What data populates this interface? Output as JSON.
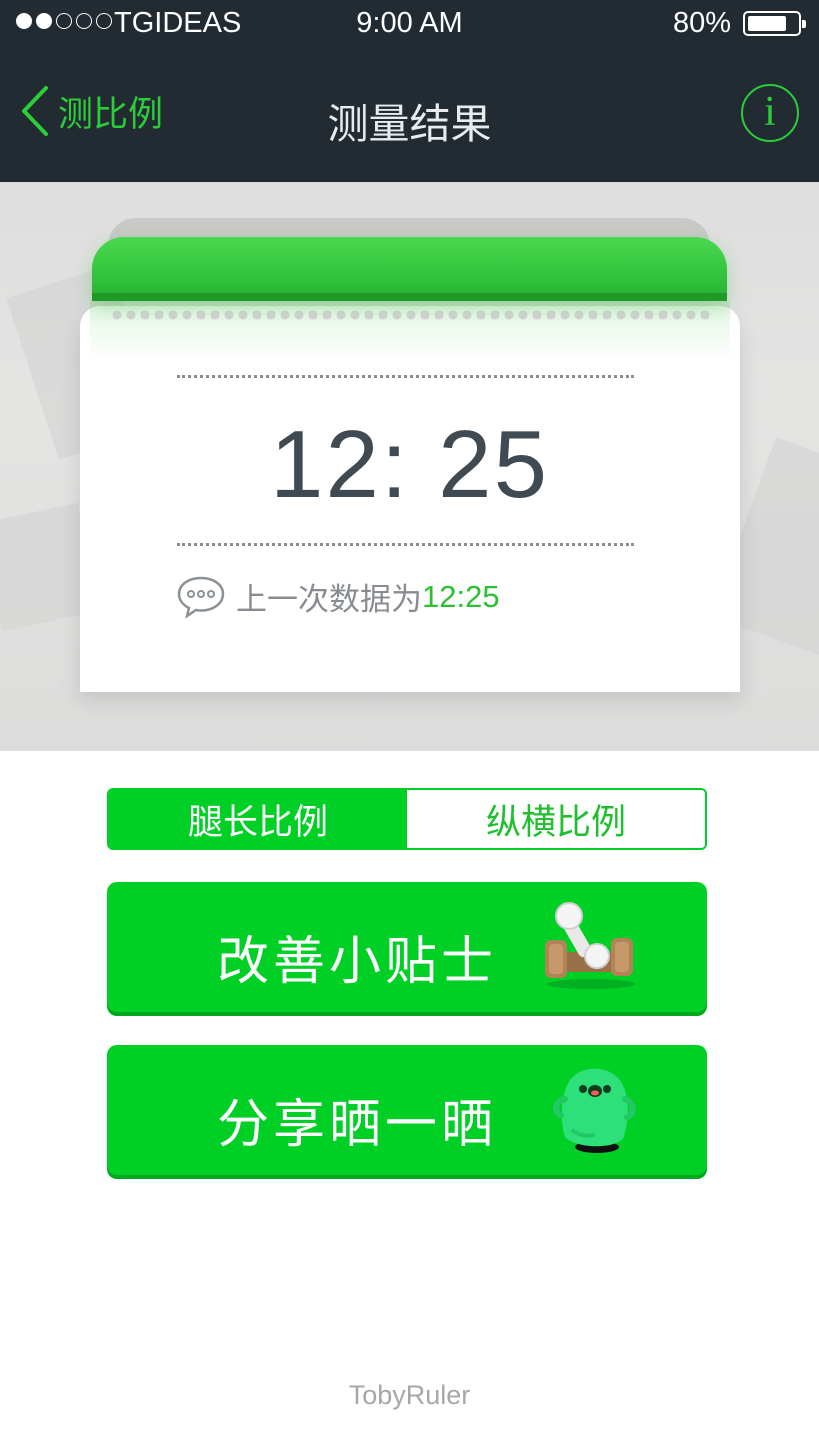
{
  "status_bar": {
    "carrier": "TGIDEAS",
    "time": "9:00 AM",
    "battery_text": "80%",
    "battery_level": 0.8,
    "signal_filled": 2,
    "signal_total": 5
  },
  "nav": {
    "back_label": "测比例",
    "title": "测量结果",
    "info_glyph": "i"
  },
  "result": {
    "value": "12: 25",
    "previous_label": "上一次数据为",
    "previous_value": "12:25"
  },
  "segments": [
    {
      "label": "腿长比例",
      "selected": true
    },
    {
      "label": "纵横比例",
      "selected": false
    }
  ],
  "buttons": {
    "tips_label": "改善小贴士",
    "tips_icon": "dumbbell-icon",
    "share_label": "分享晒一晒",
    "share_icon": "mascot-icon"
  },
  "footer": {
    "brand": "TobyRuler"
  },
  "colors": {
    "header_bg": "#212b31",
    "accent_green": "#00d026",
    "nav_green": "#2bcd38",
    "value_text": "#3f4a53"
  }
}
